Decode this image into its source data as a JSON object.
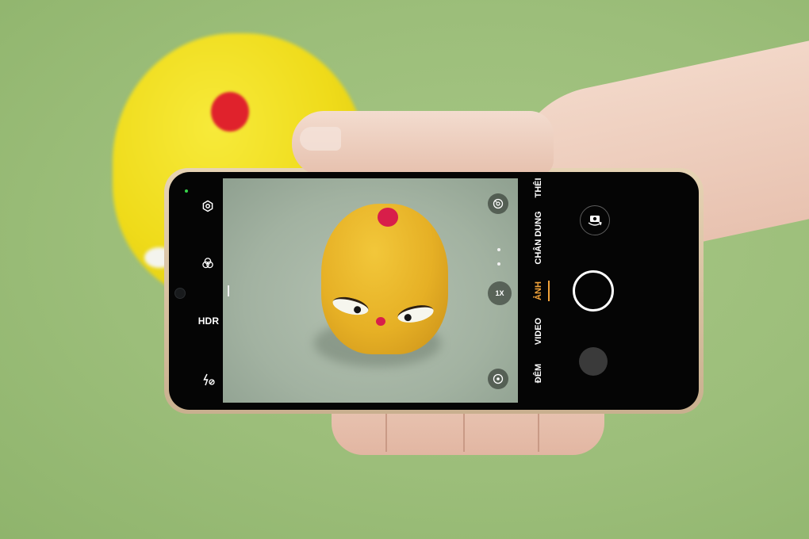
{
  "camera_ui": {
    "left_controls": {
      "settings_icon": "gear-icon",
      "filter_icon": "filter-circles-icon",
      "hdr_label": "HDR",
      "flash_icon": "flash-off-icon"
    },
    "viewfinder": {
      "top_icon": "ai-scene-icon",
      "zoom_label": "1X",
      "bottom_icon": "focus-target-icon"
    },
    "modes": [
      {
        "label": "THÊI",
        "active": false
      },
      {
        "label": "CHÂN DUNG",
        "active": false
      },
      {
        "label": "ẢNH",
        "active": true
      },
      {
        "label": "VIDEO",
        "active": false
      },
      {
        "label": "ĐÊM",
        "active": false
      }
    ],
    "right_controls": {
      "flip_icon": "camera-switch-icon",
      "shutter_icon": "shutter-button",
      "gallery_icon": "gallery-thumbnail"
    },
    "colors": {
      "active_mode": "#f2a33a",
      "background": "#9cbe7a",
      "subject": "#e6b025"
    }
  }
}
